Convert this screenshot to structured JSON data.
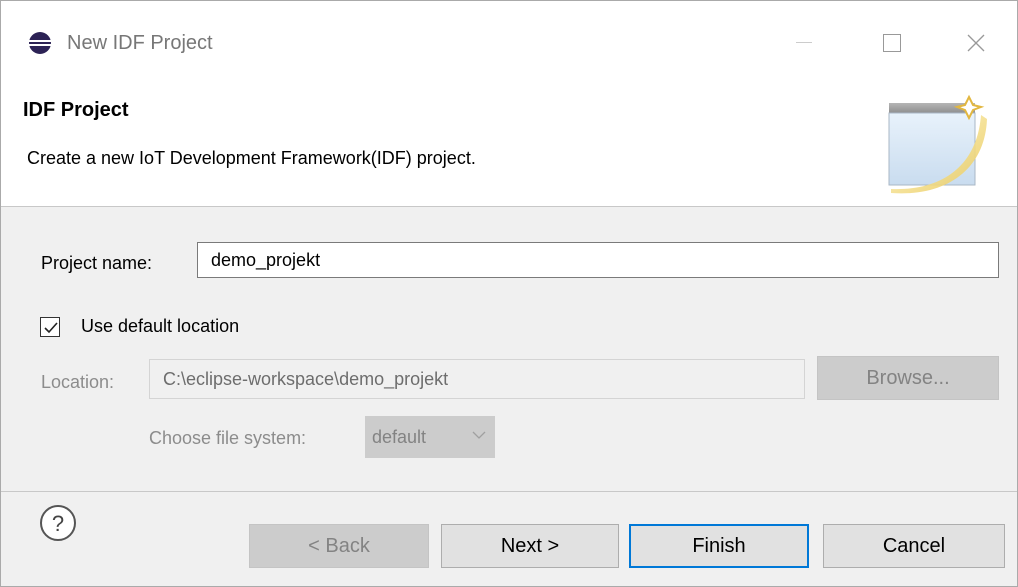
{
  "window": {
    "title": "New IDF Project"
  },
  "banner": {
    "title": "IDF Project",
    "description": "Create a new IoT Development Framework(IDF) project."
  },
  "form": {
    "project_name_label": "Project name:",
    "project_name_value": "demo_projekt",
    "use_default_location_label": "Use default location",
    "use_default_location_checked": true,
    "location_label": "Location:",
    "location_value": "C:\\eclipse-workspace\\demo_projekt",
    "browse_label": "Browse...",
    "file_system_label": "Choose file system:",
    "file_system_value": "default"
  },
  "footer": {
    "back_label": "< Back",
    "next_label": "Next >",
    "finish_label": "Finish",
    "cancel_label": "Cancel"
  },
  "colors": {
    "accent": "#0078d7",
    "disabled_text": "#838383"
  },
  "icons": {
    "app": "eclipse-icon",
    "help": "help-icon",
    "banner": "new-project-wizard-icon"
  }
}
